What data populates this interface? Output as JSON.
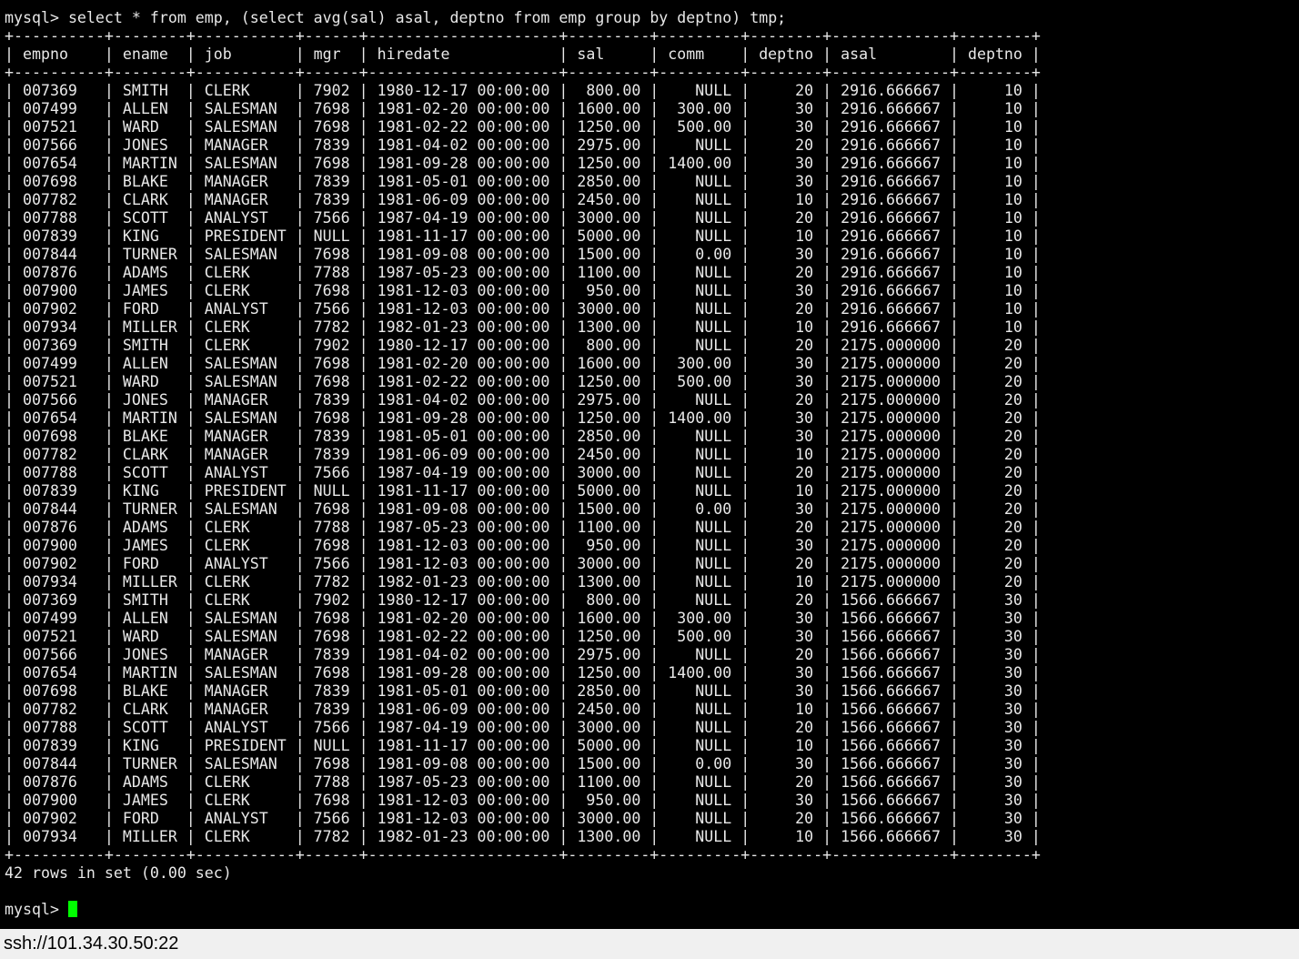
{
  "terminal": {
    "prompt": "mysql> ",
    "command": "select * from emp, (select avg(sal) asal, deptno from emp group by deptno) tmp;",
    "table": {
      "columns": [
        {
          "name": "empno",
          "width": 8,
          "align": "left"
        },
        {
          "name": "ename",
          "width": 6,
          "align": "left"
        },
        {
          "name": "job",
          "width": 9,
          "align": "left"
        },
        {
          "name": "mgr",
          "width": 4,
          "align": "right"
        },
        {
          "name": "hiredate",
          "width": 19,
          "align": "left"
        },
        {
          "name": "sal",
          "width": 7,
          "align": "right"
        },
        {
          "name": "comm",
          "width": 7,
          "align": "right"
        },
        {
          "name": "deptno",
          "width": 6,
          "align": "right"
        },
        {
          "name": "asal",
          "width": 11,
          "align": "left"
        },
        {
          "name": "deptno",
          "width": 6,
          "align": "right"
        }
      ],
      "rows": [
        [
          "007369",
          "SMITH",
          "CLERK",
          "7902",
          "1980-12-17 00:00:00",
          "800.00",
          "NULL",
          "20",
          "2916.666667",
          "10"
        ],
        [
          "007499",
          "ALLEN",
          "SALESMAN",
          "7698",
          "1981-02-20 00:00:00",
          "1600.00",
          "300.00",
          "30",
          "2916.666667",
          "10"
        ],
        [
          "007521",
          "WARD",
          "SALESMAN",
          "7698",
          "1981-02-22 00:00:00",
          "1250.00",
          "500.00",
          "30",
          "2916.666667",
          "10"
        ],
        [
          "007566",
          "JONES",
          "MANAGER",
          "7839",
          "1981-04-02 00:00:00",
          "2975.00",
          "NULL",
          "20",
          "2916.666667",
          "10"
        ],
        [
          "007654",
          "MARTIN",
          "SALESMAN",
          "7698",
          "1981-09-28 00:00:00",
          "1250.00",
          "1400.00",
          "30",
          "2916.666667",
          "10"
        ],
        [
          "007698",
          "BLAKE",
          "MANAGER",
          "7839",
          "1981-05-01 00:00:00",
          "2850.00",
          "NULL",
          "30",
          "2916.666667",
          "10"
        ],
        [
          "007782",
          "CLARK",
          "MANAGER",
          "7839",
          "1981-06-09 00:00:00",
          "2450.00",
          "NULL",
          "10",
          "2916.666667",
          "10"
        ],
        [
          "007788",
          "SCOTT",
          "ANALYST",
          "7566",
          "1987-04-19 00:00:00",
          "3000.00",
          "NULL",
          "20",
          "2916.666667",
          "10"
        ],
        [
          "007839",
          "KING",
          "PRESIDENT",
          "NULL",
          "1981-11-17 00:00:00",
          "5000.00",
          "NULL",
          "10",
          "2916.666667",
          "10"
        ],
        [
          "007844",
          "TURNER",
          "SALESMAN",
          "7698",
          "1981-09-08 00:00:00",
          "1500.00",
          "0.00",
          "30",
          "2916.666667",
          "10"
        ],
        [
          "007876",
          "ADAMS",
          "CLERK",
          "7788",
          "1987-05-23 00:00:00",
          "1100.00",
          "NULL",
          "20",
          "2916.666667",
          "10"
        ],
        [
          "007900",
          "JAMES",
          "CLERK",
          "7698",
          "1981-12-03 00:00:00",
          "950.00",
          "NULL",
          "30",
          "2916.666667",
          "10"
        ],
        [
          "007902",
          "FORD",
          "ANALYST",
          "7566",
          "1981-12-03 00:00:00",
          "3000.00",
          "NULL",
          "20",
          "2916.666667",
          "10"
        ],
        [
          "007934",
          "MILLER",
          "CLERK",
          "7782",
          "1982-01-23 00:00:00",
          "1300.00",
          "NULL",
          "10",
          "2916.666667",
          "10"
        ],
        [
          "007369",
          "SMITH",
          "CLERK",
          "7902",
          "1980-12-17 00:00:00",
          "800.00",
          "NULL",
          "20",
          "2175.000000",
          "20"
        ],
        [
          "007499",
          "ALLEN",
          "SALESMAN",
          "7698",
          "1981-02-20 00:00:00",
          "1600.00",
          "300.00",
          "30",
          "2175.000000",
          "20"
        ],
        [
          "007521",
          "WARD",
          "SALESMAN",
          "7698",
          "1981-02-22 00:00:00",
          "1250.00",
          "500.00",
          "30",
          "2175.000000",
          "20"
        ],
        [
          "007566",
          "JONES",
          "MANAGER",
          "7839",
          "1981-04-02 00:00:00",
          "2975.00",
          "NULL",
          "20",
          "2175.000000",
          "20"
        ],
        [
          "007654",
          "MARTIN",
          "SALESMAN",
          "7698",
          "1981-09-28 00:00:00",
          "1250.00",
          "1400.00",
          "30",
          "2175.000000",
          "20"
        ],
        [
          "007698",
          "BLAKE",
          "MANAGER",
          "7839",
          "1981-05-01 00:00:00",
          "2850.00",
          "NULL",
          "30",
          "2175.000000",
          "20"
        ],
        [
          "007782",
          "CLARK",
          "MANAGER",
          "7839",
          "1981-06-09 00:00:00",
          "2450.00",
          "NULL",
          "10",
          "2175.000000",
          "20"
        ],
        [
          "007788",
          "SCOTT",
          "ANALYST",
          "7566",
          "1987-04-19 00:00:00",
          "3000.00",
          "NULL",
          "20",
          "2175.000000",
          "20"
        ],
        [
          "007839",
          "KING",
          "PRESIDENT",
          "NULL",
          "1981-11-17 00:00:00",
          "5000.00",
          "NULL",
          "10",
          "2175.000000",
          "20"
        ],
        [
          "007844",
          "TURNER",
          "SALESMAN",
          "7698",
          "1981-09-08 00:00:00",
          "1500.00",
          "0.00",
          "30",
          "2175.000000",
          "20"
        ],
        [
          "007876",
          "ADAMS",
          "CLERK",
          "7788",
          "1987-05-23 00:00:00",
          "1100.00",
          "NULL",
          "20",
          "2175.000000",
          "20"
        ],
        [
          "007900",
          "JAMES",
          "CLERK",
          "7698",
          "1981-12-03 00:00:00",
          "950.00",
          "NULL",
          "30",
          "2175.000000",
          "20"
        ],
        [
          "007902",
          "FORD",
          "ANALYST",
          "7566",
          "1981-12-03 00:00:00",
          "3000.00",
          "NULL",
          "20",
          "2175.000000",
          "20"
        ],
        [
          "007934",
          "MILLER",
          "CLERK",
          "7782",
          "1982-01-23 00:00:00",
          "1300.00",
          "NULL",
          "10",
          "2175.000000",
          "20"
        ],
        [
          "007369",
          "SMITH",
          "CLERK",
          "7902",
          "1980-12-17 00:00:00",
          "800.00",
          "NULL",
          "20",
          "1566.666667",
          "30"
        ],
        [
          "007499",
          "ALLEN",
          "SALESMAN",
          "7698",
          "1981-02-20 00:00:00",
          "1600.00",
          "300.00",
          "30",
          "1566.666667",
          "30"
        ],
        [
          "007521",
          "WARD",
          "SALESMAN",
          "7698",
          "1981-02-22 00:00:00",
          "1250.00",
          "500.00",
          "30",
          "1566.666667",
          "30"
        ],
        [
          "007566",
          "JONES",
          "MANAGER",
          "7839",
          "1981-04-02 00:00:00",
          "2975.00",
          "NULL",
          "20",
          "1566.666667",
          "30"
        ],
        [
          "007654",
          "MARTIN",
          "SALESMAN",
          "7698",
          "1981-09-28 00:00:00",
          "1250.00",
          "1400.00",
          "30",
          "1566.666667",
          "30"
        ],
        [
          "007698",
          "BLAKE",
          "MANAGER",
          "7839",
          "1981-05-01 00:00:00",
          "2850.00",
          "NULL",
          "30",
          "1566.666667",
          "30"
        ],
        [
          "007782",
          "CLARK",
          "MANAGER",
          "7839",
          "1981-06-09 00:00:00",
          "2450.00",
          "NULL",
          "10",
          "1566.666667",
          "30"
        ],
        [
          "007788",
          "SCOTT",
          "ANALYST",
          "7566",
          "1987-04-19 00:00:00",
          "3000.00",
          "NULL",
          "20",
          "1566.666667",
          "30"
        ],
        [
          "007839",
          "KING",
          "PRESIDENT",
          "NULL",
          "1981-11-17 00:00:00",
          "5000.00",
          "NULL",
          "10",
          "1566.666667",
          "30"
        ],
        [
          "007844",
          "TURNER",
          "SALESMAN",
          "7698",
          "1981-09-08 00:00:00",
          "1500.00",
          "0.00",
          "30",
          "1566.666667",
          "30"
        ],
        [
          "007876",
          "ADAMS",
          "CLERK",
          "7788",
          "1987-05-23 00:00:00",
          "1100.00",
          "NULL",
          "20",
          "1566.666667",
          "30"
        ],
        [
          "007900",
          "JAMES",
          "CLERK",
          "7698",
          "1981-12-03 00:00:00",
          "950.00",
          "NULL",
          "30",
          "1566.666667",
          "30"
        ],
        [
          "007902",
          "FORD",
          "ANALYST",
          "7566",
          "1981-12-03 00:00:00",
          "3000.00",
          "NULL",
          "20",
          "1566.666667",
          "30"
        ],
        [
          "007934",
          "MILLER",
          "CLERK",
          "7782",
          "1982-01-23 00:00:00",
          "1300.00",
          "NULL",
          "10",
          "1566.666667",
          "30"
        ]
      ]
    },
    "result_summary": "42 rows in set (0.00 sec)",
    "cursor_color": "#00ff00"
  },
  "statusbar": {
    "connection": "ssh://101.34.30.50:22"
  }
}
